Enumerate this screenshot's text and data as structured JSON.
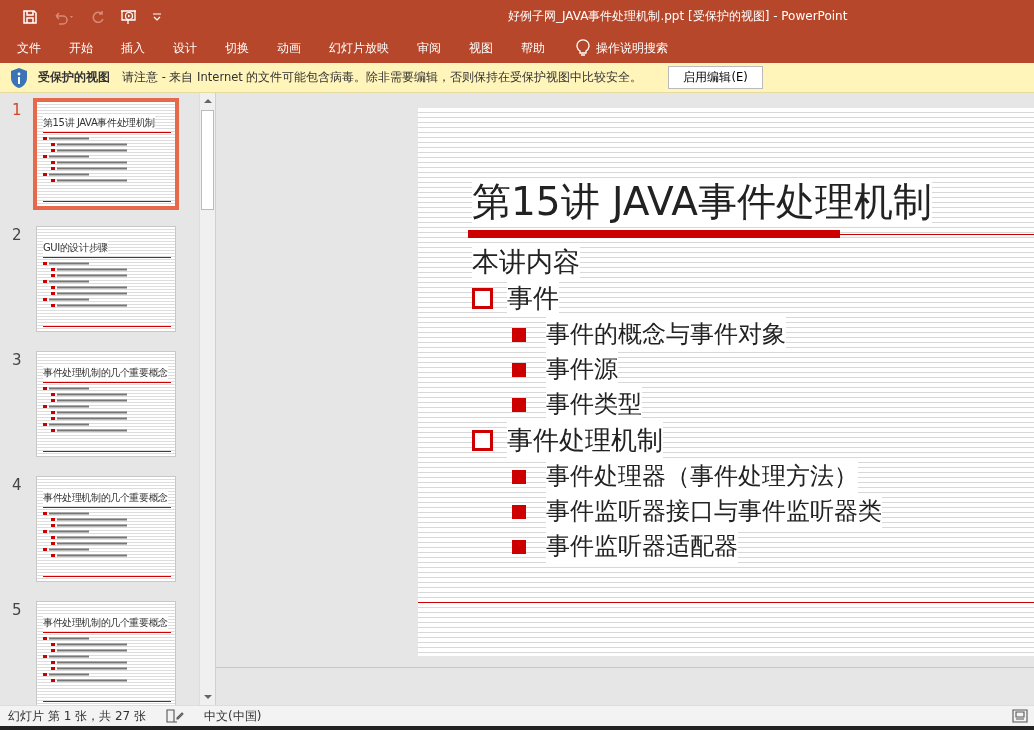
{
  "title_bar": {
    "title": "好例子网_JAVA事件处理机制.ppt [受保护的视图]  -  PowerPoint"
  },
  "menu": [
    "文件",
    "开始",
    "插入",
    "设计",
    "切换",
    "动画",
    "幻灯片放映",
    "审阅",
    "视图",
    "帮助"
  ],
  "tell_me": {
    "label": "操作说明搜索"
  },
  "protected_view_bar": {
    "title": "受保护的视图",
    "message": "请注意 - 来自 Internet 的文件可能包含病毒。除非需要编辑，否则保持在受保护视图中比较安全。",
    "button": "启用编辑(E)"
  },
  "thumbnails": [
    {
      "number": "1",
      "selected": true,
      "title": "第15讲 JAVA事件处理机制"
    },
    {
      "number": "2",
      "selected": false,
      "title": "GUI的设计步骤"
    },
    {
      "number": "3",
      "selected": false,
      "title": "事件处理机制的几个重要概念"
    },
    {
      "number": "4",
      "selected": false,
      "title": "事件处理机制的几个重要概念"
    },
    {
      "number": "5",
      "selected": false,
      "title": "事件处理机制的几个重要概念"
    }
  ],
  "slide": {
    "title": "第15讲 JAVA事件处理机制",
    "subtitle": "本讲内容",
    "items": [
      {
        "text": "事件",
        "children": [
          {
            "text": "事件的概念与事件对象"
          },
          {
            "text": "事件源"
          },
          {
            "text": "事件类型"
          }
        ]
      },
      {
        "text": "事件处理机制",
        "children": [
          {
            "text": "事件处理器（事件处理方法）"
          },
          {
            "text": "事件监听器接口与事件监听器类"
          },
          {
            "text": "事件监听器适配器"
          }
        ]
      }
    ]
  },
  "status_bar": {
    "slide_count": "幻灯片 第 1 张，共 27 张",
    "language": "中文(中国)"
  }
}
